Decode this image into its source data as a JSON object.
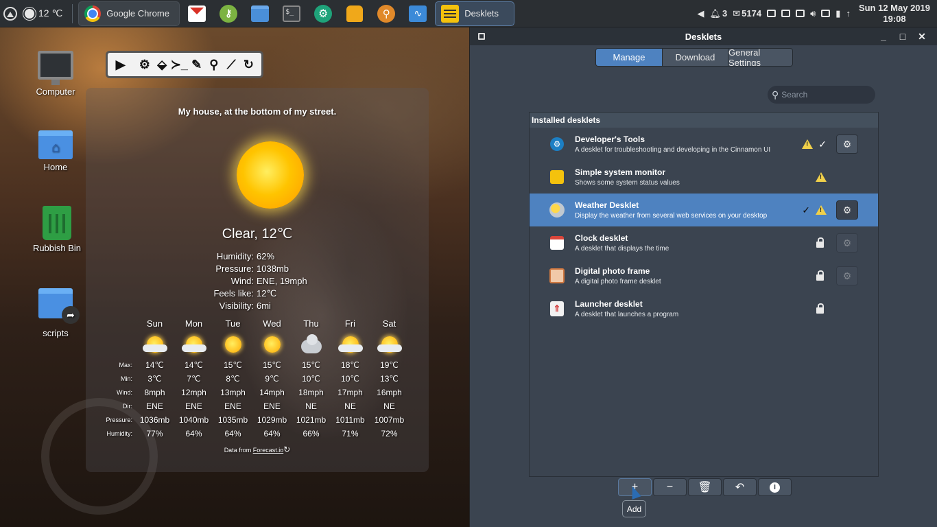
{
  "panel": {
    "weather_temp": "12 ℃",
    "tasks": [
      {
        "label": "Google Chrome"
      },
      {
        "label": "Desklets"
      }
    ],
    "launchers": [
      "gmail",
      "keepass",
      "files",
      "terminal",
      "settings",
      "package-manager",
      "search",
      "system-monitor"
    ],
    "tray": {
      "notifications": "3",
      "mail_count": "5174"
    },
    "clock": {
      "date": "Sun 12 May 2019",
      "time": "19:08"
    }
  },
  "desktop_icons": [
    {
      "label": "Computer"
    },
    {
      "label": "Home"
    },
    {
      "label": "Rubbish Bin"
    },
    {
      "label": "scripts"
    }
  ],
  "weather": {
    "location": "My house, at the bottom of my street.",
    "condition": "Clear, 12℃",
    "details": [
      {
        "key": "Humidity:",
        "value": "62%"
      },
      {
        "key": "Pressure:",
        "value": "1038mb"
      },
      {
        "key": "Wind:",
        "value": "ENE, 19mph"
      },
      {
        "key": "Feels like:",
        "value": "12℃"
      },
      {
        "key": "Visibility:",
        "value": "6mi"
      }
    ],
    "forecast": {
      "days": [
        "Sun",
        "Mon",
        "Tue",
        "Wed",
        "Thu",
        "Fri",
        "Sat"
      ],
      "icons": [
        "partly-cloudy",
        "partly-cloudy",
        "sun",
        "sun",
        "cloudy",
        "partly-cloudy",
        "partly-cloudy"
      ],
      "rows": [
        {
          "key": "Max:",
          "values": [
            "14℃",
            "14℃",
            "15℃",
            "15℃",
            "15℃",
            "18℃",
            "19℃"
          ]
        },
        {
          "key": "Min:",
          "values": [
            "3℃",
            "7℃",
            "8℃",
            "9℃",
            "10℃",
            "10℃",
            "13℃"
          ]
        },
        {
          "key": "Wind:",
          "values": [
            "8mph",
            "12mph",
            "13mph",
            "14mph",
            "18mph",
            "17mph",
            "16mph"
          ]
        },
        {
          "key": "Dir:",
          "values": [
            "ENE",
            "ENE",
            "ENE",
            "ENE",
            "NE",
            "NE",
            "NE"
          ]
        },
        {
          "key": "Pressure:",
          "values": [
            "1036mb",
            "1040mb",
            "1035mb",
            "1029mb",
            "1021mb",
            "1011mb",
            "1007mb"
          ]
        },
        {
          "key": "Humidity:",
          "values": [
            "77%",
            "64%",
            "64%",
            "64%",
            "66%",
            "71%",
            "72%"
          ]
        }
      ]
    },
    "credit_prefix": "Data from ",
    "credit_link": "Forecast.io"
  },
  "window": {
    "title": "Desklets",
    "tabs": [
      {
        "label": "Manage"
      },
      {
        "label": "Download"
      },
      {
        "label": "General Settings"
      }
    ],
    "search_placeholder": "Search",
    "list_header": "Installed desklets",
    "desklets": [
      {
        "title": "Developer's Tools",
        "desc": "A desklet for troubleshooting and developing in the Cinnamon UI",
        "icon": "gear-icon"
      },
      {
        "title": "Simple system monitor",
        "desc": "Shows some system status values",
        "icon": "notes-icon"
      },
      {
        "title": "Weather Desklet",
        "desc": "Display the weather from several web services on your desktop",
        "icon": "weather-icon"
      },
      {
        "title": "Clock desklet",
        "desc": "A desklet that displays the time",
        "icon": "calendar-icon"
      },
      {
        "title": "Digital photo frame",
        "desc": "A digital photo frame desklet",
        "icon": "photo-icon"
      },
      {
        "title": "Launcher desklet",
        "desc": "A desklet that launches a program",
        "icon": "launcher-icon"
      }
    ],
    "tooltip": "Add"
  },
  "colors": {
    "accent": "#4e82c0",
    "panel_bg": "#2b2f33",
    "window_bg": "#3b4450",
    "warning": "#f0d04a"
  }
}
